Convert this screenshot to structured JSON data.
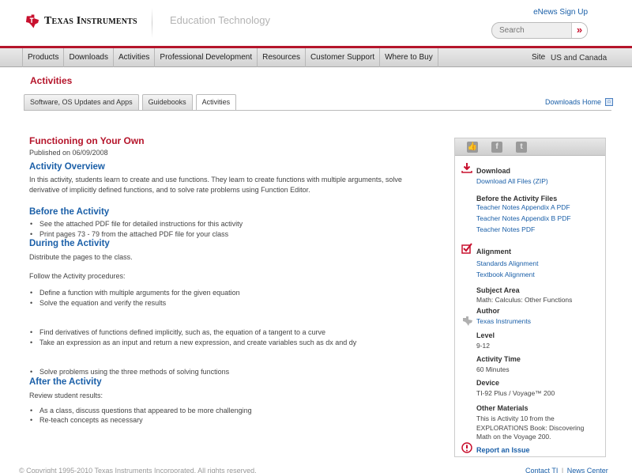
{
  "header": {
    "logo_text": "Texas Instruments",
    "section": "Education Technology",
    "enews_label": "eNews Sign Up",
    "search_placeholder": "Search",
    "search_button": "»"
  },
  "nav": {
    "items": [
      "Products",
      "Downloads",
      "Activities",
      "Professional Development",
      "Resources",
      "Customer Support",
      "Where to Buy"
    ],
    "site_label": "Site",
    "site_value": "US and Canada"
  },
  "page": {
    "section_title": "Activities",
    "tabs": [
      "Software, OS Updates and Apps",
      "Guidebooks",
      "Activities"
    ],
    "active_tab": "Activities",
    "downloads_home": "Downloads Home"
  },
  "activity": {
    "title": "Functioning on Your Own",
    "published": "Published on 06/09/2008",
    "overview_heading": "Activity Overview",
    "overview_text": "In this activity, students learn to create and use functions. They learn to create functions with multiple arguments, solve derivative of implicitly defined functions, and to solve rate problems using Function Editor.",
    "before_heading": "Before the Activity",
    "before_items": [
      "See the attached PDF file for detailed instructions for this activity",
      "Print pages 73 - 79 from the attached PDF file for your class"
    ],
    "during_heading": "During the Activity",
    "during_text1": "Distribute the pages to the class.",
    "during_text2": "Follow the Activity procedures:",
    "during_items_a": [
      "Define a function with multiple arguments for the given equation",
      "Solve the equation and verify the results"
    ],
    "during_items_b": [
      "Find derivatives of functions defined implicitly, such as, the equation of a tangent to a curve",
      "Take an expression as an input and return a new expression, and create variables such as dx and dy"
    ],
    "during_items_c": [
      "Solve problems using the three methods of solving functions"
    ],
    "after_heading": "After the Activity",
    "after_text": "Review student results:",
    "after_items": [
      "As a class, discuss questions that appeared to be more challenging",
      "Re-teach concepts as necessary"
    ]
  },
  "sidebar": {
    "social_icons": [
      "like-icon",
      "facebook-icon",
      "twitter-icon"
    ],
    "download_heading": "Download",
    "download_all": "Download All Files (ZIP)",
    "before_files_heading": "Before the Activity Files",
    "before_files": [
      "Teacher Notes Appendix A PDF",
      "Teacher Notes Appendix B PDF",
      "Teacher Notes PDF"
    ],
    "alignment_heading": "Alignment",
    "alignment_links": [
      "Standards Alignment",
      "Textbook Alignment"
    ],
    "subject_heading": "Subject Area",
    "subject_value": "Math: Calculus: Other Functions",
    "author_heading": "Author",
    "author_value": "Texas Instruments",
    "level_heading": "Level",
    "level_value": "9-12",
    "time_heading": "Activity Time",
    "time_value": "60 Minutes",
    "device_heading": "Device",
    "device_value": "TI-92 Plus / Voyage™ 200",
    "other_heading": "Other Materials",
    "other_value": "This is Activity 10 from the EXPLORATIONS Book: Discovering Math on the Voyage 200.",
    "report_issue": "Report an Issue"
  },
  "footer": {
    "copyright": "© Copyright 1995-2010 Texas Instruments Incorporated. All rights reserved.",
    "contact": "Contact TI",
    "separator": "|",
    "news": "News Center"
  },
  "colors": {
    "brand_red": "#b5152b",
    "link_blue": "#1a5fa8"
  }
}
